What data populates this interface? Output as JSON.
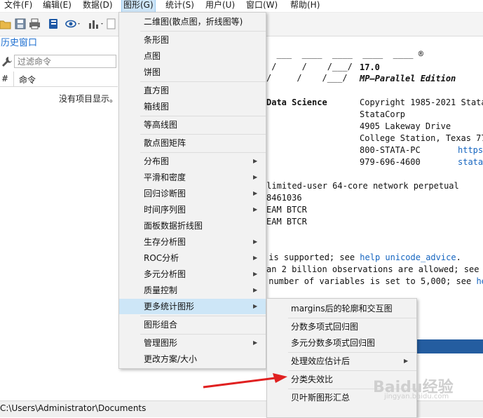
{
  "menubar": {
    "items": [
      {
        "label": "文件(F)"
      },
      {
        "label": "编辑(E)"
      },
      {
        "label": "数据(D)"
      },
      {
        "label": "图形(G)"
      },
      {
        "label": "统计(S)"
      },
      {
        "label": "用户(U)"
      },
      {
        "label": "窗口(W)"
      },
      {
        "label": "帮助(H)"
      }
    ]
  },
  "history": {
    "title": "历史窗口",
    "filter_placeholder": "过滤命令",
    "col_num": "#",
    "col_command": "命令",
    "empty_message": "没有项目显示。"
  },
  "results": {
    "logo_line1": "  ___  ____  ____  ____  ____ ®",
    "logo_line2": " /     /    /___/",
    "logo_line3": "/     /    /___/",
    "version": "17.0",
    "edition": "MP—Parallel Edition",
    "data_science": "Data Science",
    "copyright": "Copyright 1985-2021 Stata",
    "company": "StataCorp",
    "address1": "4905 Lakeway Drive",
    "address2": "College Station, Texas 77",
    "phone1": "800-STATA-PC",
    "phone1_link": "https",
    "phone2": "979-696-4600",
    "phone2_link": "stata",
    "license": "nlimited-user 64-core network perpetual",
    "serial": "8461036",
    "licensed1": "EAM BTCR",
    "licensed2": "EAM BTCR",
    "note1_pre": " is supported; see ",
    "note1_link": "help unicode_advice",
    "note1_post": ".",
    "note2_pre": "an 2 billion observations are allowed; see ",
    "note2_link": "h",
    "note3_pre": " number of variables is set to 5,000; see ",
    "note3_link": "he"
  },
  "graphics_menu": {
    "items": [
      {
        "label": "二维图(散点图，折线图等)",
        "submenu": false
      },
      {
        "label": "条形图",
        "submenu": false
      },
      {
        "label": "点图",
        "submenu": false
      },
      {
        "label": "饼图",
        "submenu": false
      },
      {
        "label": "直方图",
        "submenu": false
      },
      {
        "label": "箱线图",
        "submenu": false
      },
      {
        "label": "等高线图",
        "submenu": false
      },
      {
        "label": "散点图矩阵",
        "submenu": false
      },
      {
        "label": "分布图",
        "submenu": true
      },
      {
        "label": "平滑和密度",
        "submenu": true
      },
      {
        "label": "回归诊断图",
        "submenu": true
      },
      {
        "label": "时间序列图",
        "submenu": true
      },
      {
        "label": "面板数据折线图",
        "submenu": false
      },
      {
        "label": "生存分析图",
        "submenu": true
      },
      {
        "label": "ROC分析",
        "submenu": true
      },
      {
        "label": "多元分析图",
        "submenu": true
      },
      {
        "label": "质量控制",
        "submenu": true
      },
      {
        "label": "更多统计图形",
        "submenu": true,
        "highlighted": true
      },
      {
        "label": "图形组合",
        "submenu": false
      },
      {
        "label": "管理图形",
        "submenu": true
      },
      {
        "label": "更改方案/大小",
        "submenu": false
      }
    ]
  },
  "sub_menu": {
    "items": [
      {
        "label": "margins后的轮廓和交互图",
        "submenu": false
      },
      {
        "label": "分数多项式回归图",
        "submenu": false
      },
      {
        "label": "多元分数多项式回归图",
        "submenu": false
      },
      {
        "label": "处理效应估计后",
        "submenu": true
      },
      {
        "label": "分类失效比",
        "submenu": false
      },
      {
        "label": "贝叶斯图形汇总",
        "submenu": false
      }
    ]
  },
  "status": {
    "path": "C:\\Users\\Administrator\\Documents"
  },
  "watermark": {
    "text": "Baidu经验",
    "subtext": "jingyan.baidu.com"
  },
  "colors": {
    "accent": "#1e6fd0",
    "menu_highlight": "#cde6f7",
    "arrow_red": "#e02020",
    "band_blue": "#245da0"
  }
}
